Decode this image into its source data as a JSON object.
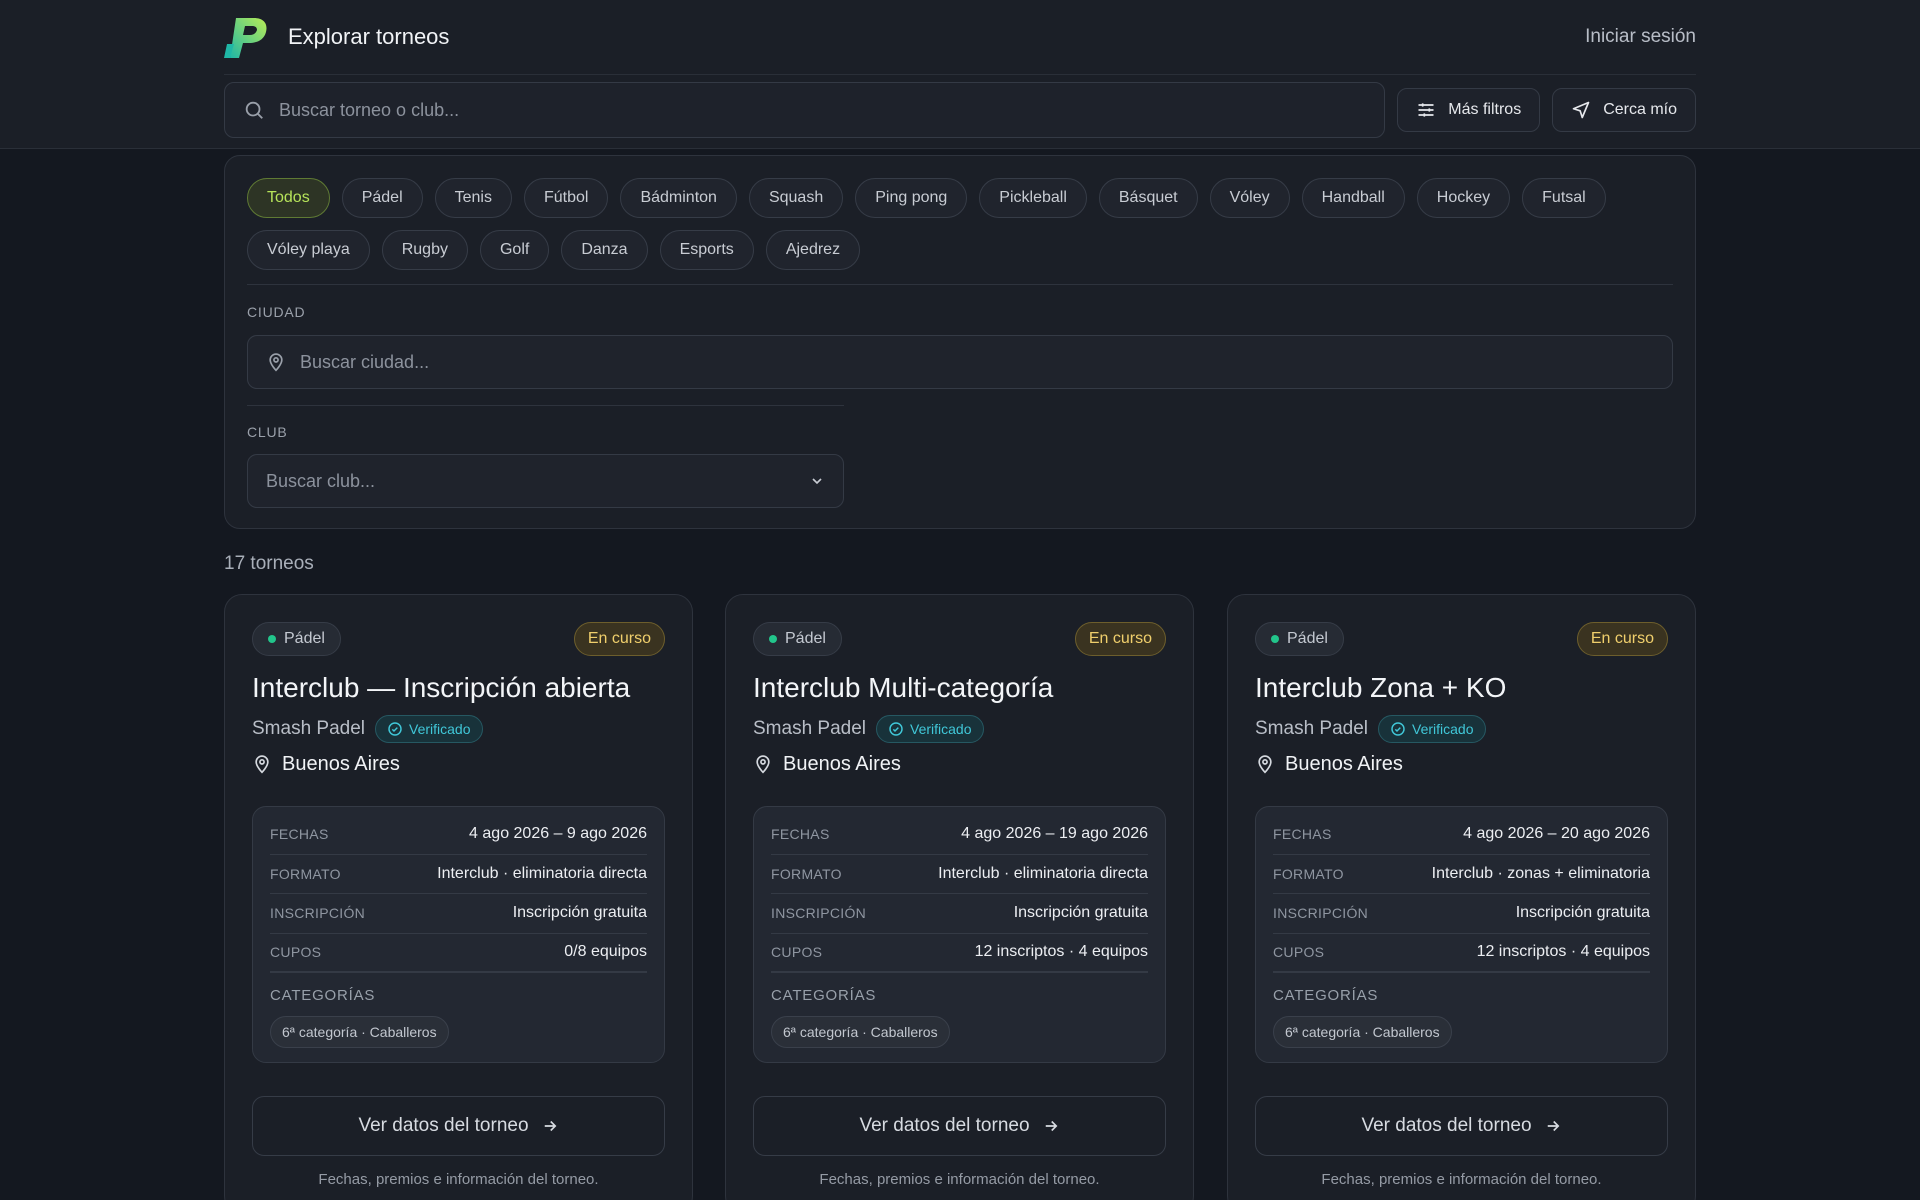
{
  "header": {
    "title": "Explorar torneos",
    "login_label": "Iniciar sesión",
    "search_placeholder": "Buscar torneo o club...",
    "more_filters_label": "Más filtros",
    "near_me_label": "Cerca mío"
  },
  "sports": [
    "Todos",
    "Pádel",
    "Tenis",
    "Fútbol",
    "Bádminton",
    "Squash",
    "Ping pong",
    "Pickleball",
    "Básquet",
    "Vóley",
    "Handball",
    "Hockey",
    "Futsal",
    "Vóley playa",
    "Rugby",
    "Golf",
    "Danza",
    "Esports",
    "Ajedrez"
  ],
  "active_sport": "Todos",
  "city": {
    "label": "CIUDAD",
    "placeholder": "Buscar ciudad..."
  },
  "club": {
    "label": "CLUB",
    "placeholder": "Buscar club..."
  },
  "results_count": "17 torneos",
  "detail_labels": {
    "dates": "FECHAS",
    "format": "FORMATO",
    "registration": "INSCRIPCIÓN",
    "slots": "CUPOS",
    "categories": "CATEGORÍAS"
  },
  "cards": [
    {
      "sport": "Pádel",
      "status": "En curso",
      "title": "Interclub — Inscripción abierta",
      "club": "Smash Padel",
      "verified": "Verificado",
      "city": "Buenos Aires",
      "dates": "4 ago 2026 – 9 ago 2026",
      "format": "Interclub · eliminatoria directa",
      "registration": "Inscripción gratuita",
      "slots": "0/8 equipos",
      "category": "6ª categoría · Caballeros",
      "cta": "Ver datos del torneo",
      "note": "Fechas, premios e información del torneo."
    },
    {
      "sport": "Pádel",
      "status": "En curso",
      "title": "Interclub Multi-categoría",
      "club": "Smash Padel",
      "verified": "Verificado",
      "city": "Buenos Aires",
      "dates": "4 ago 2026 – 19 ago 2026",
      "format": "Interclub · eliminatoria directa",
      "registration": "Inscripción gratuita",
      "slots": "12 inscriptos · 4 equipos",
      "category": "6ª categoría · Caballeros",
      "cta": "Ver datos del torneo",
      "note": "Fechas, premios e información del torneo."
    },
    {
      "sport": "Pádel",
      "status": "En curso",
      "title": "Interclub Zona + KO",
      "club": "Smash Padel",
      "verified": "Verificado",
      "city": "Buenos Aires",
      "dates": "4 ago 2026 – 20 ago 2026",
      "format": "Interclub · zonas + eliminatoria",
      "registration": "Inscripción gratuita",
      "slots": "12 inscriptos · 4 equipos",
      "category": "6ª categoría · Caballeros",
      "cta": "Ver datos del torneo",
      "note": "Fechas, premios e información del torneo."
    }
  ],
  "colors": {
    "background": "#141820",
    "accent_green": "#b6e35a",
    "status_yellow": "#f0cf6c",
    "verified_cyan": "#40c7d8",
    "sport_dot": "#22c58b"
  }
}
